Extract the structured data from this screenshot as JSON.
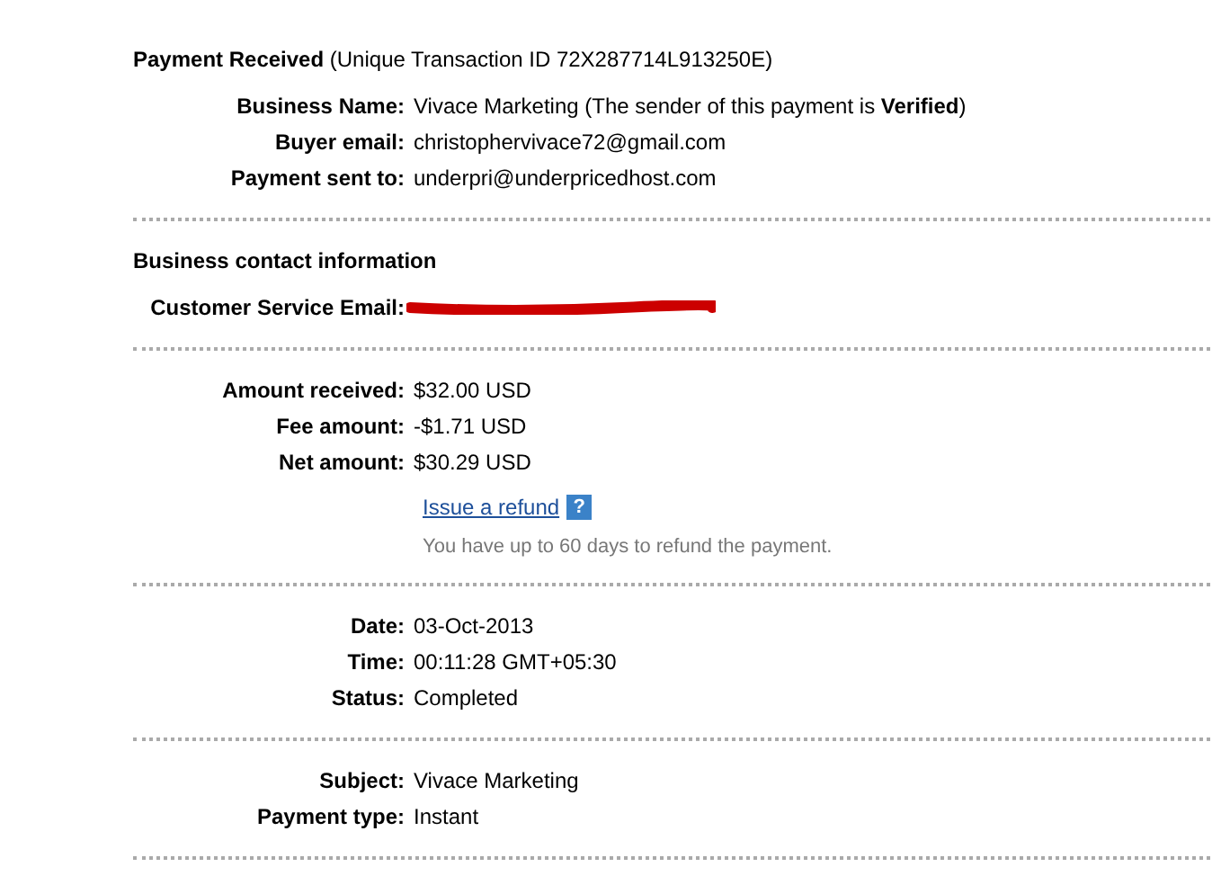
{
  "sections": [
    {
      "heading": "**Payment Received** (Unique Transaction ID 72X287714L913250E)",
      "rows": [
        {
          "kind": "text",
          "label": "Business Name:",
          "value": "Vivace Marketing (The sender of this payment is **Verified**)"
        },
        {
          "kind": "text",
          "label": "Buyer email:",
          "value": "christophervivace72@gmail.com"
        },
        {
          "kind": "text",
          "label": "Payment sent to:",
          "value": "underpri@underpricedhost.com"
        }
      ]
    },
    {
      "heading": "Business contact information",
      "heading_bold": true,
      "rows": [
        {
          "kind": "redacted",
          "label": "Customer Service Email:"
        }
      ]
    },
    {
      "rows": [
        {
          "kind": "text",
          "label": "Amount received:",
          "value": "$32.00 USD"
        },
        {
          "kind": "text",
          "label": "Fee amount:",
          "value": "-$1.71 USD"
        },
        {
          "kind": "text",
          "label": "Net amount:",
          "value": "$30.29 USD"
        }
      ],
      "refund": {
        "link": "Issue a refund",
        "help": "?",
        "note": "You have up to 60 days to refund the payment."
      }
    },
    {
      "rows": [
        {
          "kind": "text",
          "label": "Date:",
          "value": "03-Oct-2013"
        },
        {
          "kind": "text",
          "label": "Time:",
          "value": "00:11:28 GMT+05:30"
        },
        {
          "kind": "text",
          "label": "Status:",
          "value": "Completed"
        }
      ]
    },
    {
      "rows": [
        {
          "kind": "text",
          "label": "Subject:",
          "value": "Vivace Marketing"
        },
        {
          "kind": "text",
          "label": "Payment type:",
          "value": "Instant"
        }
      ]
    }
  ]
}
